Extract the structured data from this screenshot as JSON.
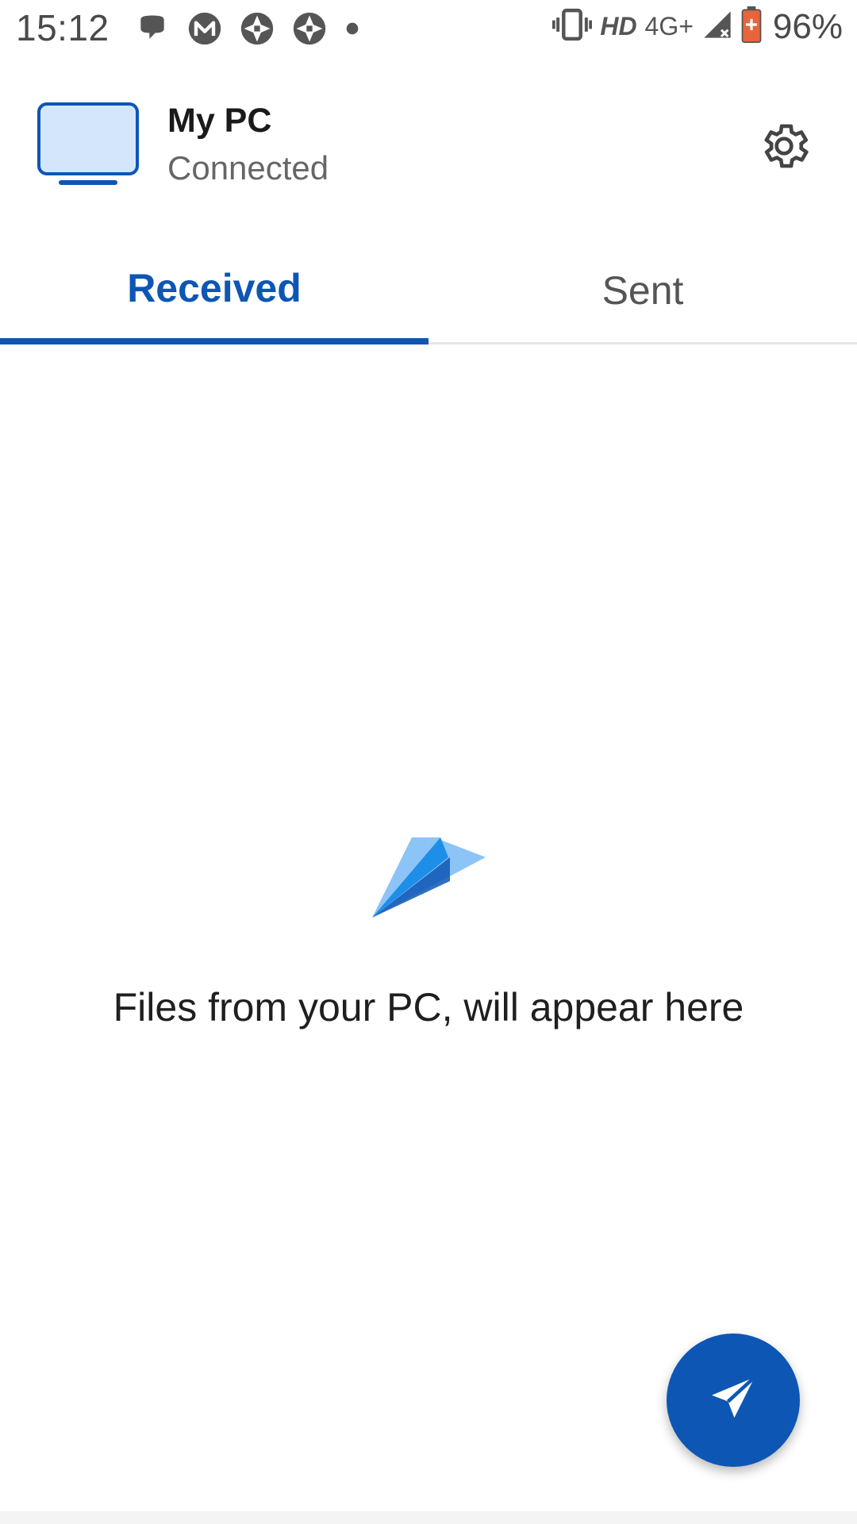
{
  "status_bar": {
    "time": "15:12",
    "left_icons": [
      "chat-bubble-icon",
      "m-app-icon",
      "aperture-icon",
      "aperture-icon",
      "dot-icon"
    ],
    "right_icons": [
      "vibrate-icon",
      "signal-icon",
      "battery-icon"
    ],
    "hd_label": "HD",
    "network_label": "4G+",
    "battery_percent": "96%"
  },
  "header": {
    "device_name": "My PC",
    "device_status": "Connected",
    "icons": {
      "device": "monitor-icon",
      "settings": "gear-icon"
    }
  },
  "tabs": [
    {
      "label": "Received",
      "active": true
    },
    {
      "label": "Sent",
      "active": false
    }
  ],
  "empty_state": {
    "icon": "paper-plane-icon",
    "message": "Files from your PC, will appear here"
  },
  "fab": {
    "icon": "send-icon"
  },
  "colors": {
    "accent": "#0d56b4",
    "monitor_fill": "#d4e6fb",
    "plane_light": "#8cc4f7",
    "plane_mid": "#1e8fe8",
    "plane_dark": "#0d56b4"
  }
}
